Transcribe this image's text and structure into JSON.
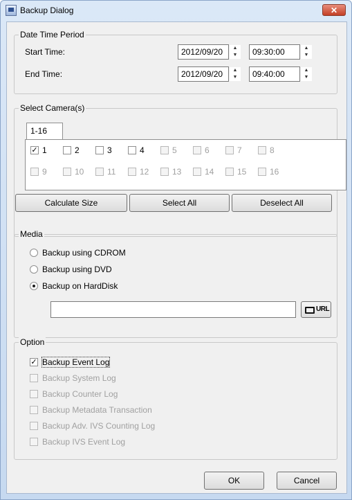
{
  "window": {
    "title": "Backup Dialog",
    "close_icon": "close-icon"
  },
  "date_time": {
    "legend": "Date Time Period",
    "start_label": "Start Time:",
    "start_date": "2012/09/20",
    "start_time": "09:30:00",
    "end_label": "End Time:",
    "end_date": "2012/09/20",
    "end_time": "09:40:00"
  },
  "cameras": {
    "legend": "Select Camera(s)",
    "tab_label": "1-16",
    "items": [
      {
        "label": "1",
        "checked": true,
        "enabled": true
      },
      {
        "label": "2",
        "checked": false,
        "enabled": true
      },
      {
        "label": "3",
        "checked": false,
        "enabled": true
      },
      {
        "label": "4",
        "checked": false,
        "enabled": true
      },
      {
        "label": "5",
        "checked": false,
        "enabled": false
      },
      {
        "label": "6",
        "checked": false,
        "enabled": false
      },
      {
        "label": "7",
        "checked": false,
        "enabled": false
      },
      {
        "label": "8",
        "checked": false,
        "enabled": false
      },
      {
        "label": "9",
        "checked": false,
        "enabled": false
      },
      {
        "label": "10",
        "checked": false,
        "enabled": false
      },
      {
        "label": "11",
        "checked": false,
        "enabled": false
      },
      {
        "label": "12",
        "checked": false,
        "enabled": false
      },
      {
        "label": "13",
        "checked": false,
        "enabled": false
      },
      {
        "label": "14",
        "checked": false,
        "enabled": false
      },
      {
        "label": "15",
        "checked": false,
        "enabled": false
      },
      {
        "label": "16",
        "checked": false,
        "enabled": false
      }
    ],
    "calc_label": "Calculate Size",
    "select_all_label": "Select All",
    "deselect_all_label": "Deselect All"
  },
  "media": {
    "legend": "Media",
    "opt_cdrom": "Backup using CDROM",
    "opt_dvd": "Backup using DVD",
    "opt_hdd": "Backup on HardDisk",
    "selected": "hdd",
    "path_value": "",
    "url_label": "URL"
  },
  "option": {
    "legend": "Option",
    "items": [
      {
        "label": "Backup Event Log",
        "checked": true,
        "enabled": true
      },
      {
        "label": "Backup System Log",
        "checked": false,
        "enabled": false
      },
      {
        "label": "Backup Counter Log",
        "checked": false,
        "enabled": false
      },
      {
        "label": "Backup Metadata Transaction",
        "checked": false,
        "enabled": false
      },
      {
        "label": "Backup Adv. IVS Counting Log",
        "checked": false,
        "enabled": false
      },
      {
        "label": "Backup IVS Event Log",
        "checked": false,
        "enabled": false
      }
    ]
  },
  "footer": {
    "ok_label": "OK",
    "cancel_label": "Cancel"
  }
}
